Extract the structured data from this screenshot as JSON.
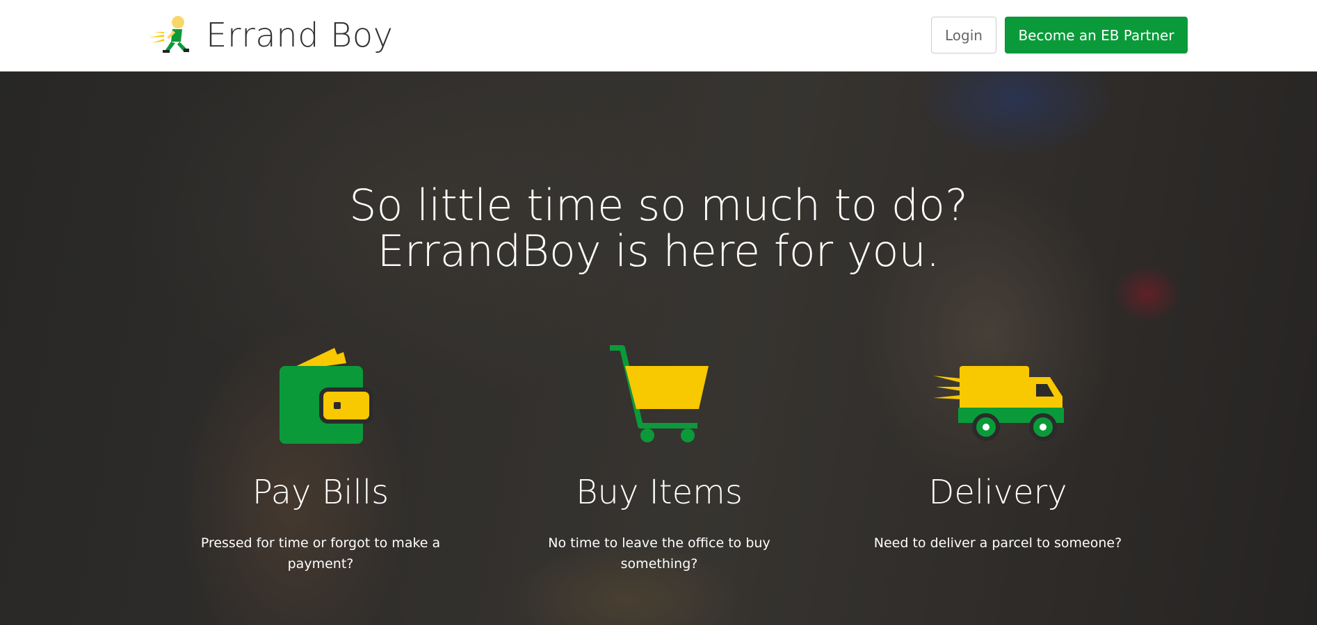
{
  "navbar": {
    "brand_name": "Errand Boy",
    "login_label": "Login",
    "partner_label": "Become an EB Partner",
    "colors": {
      "brand_green": "#0b9a3a",
      "accent_yellow": "#f8c800"
    }
  },
  "hero": {
    "headline_line1": "So little time so much to do?",
    "headline_line2": "ErrandBoy is here for you.",
    "features": [
      {
        "icon": "wallet-icon",
        "title": "Pay Bills",
        "description": "Pressed for time or forgot to make a payment?"
      },
      {
        "icon": "shopping-cart-icon",
        "title": "Buy Items",
        "description": "No time to leave the office to buy something?"
      },
      {
        "icon": "delivery-truck-icon",
        "title": "Delivery",
        "description": "Need to deliver a parcel to someone?"
      }
    ]
  }
}
